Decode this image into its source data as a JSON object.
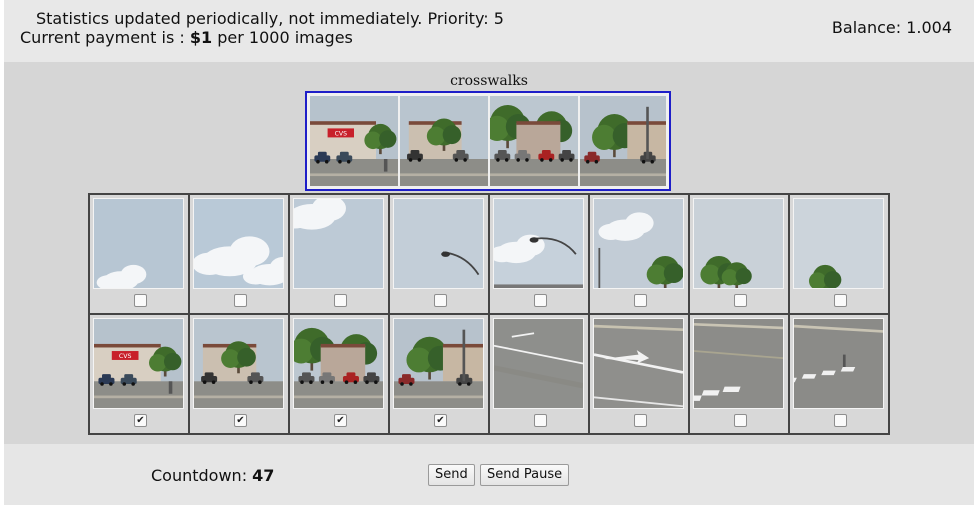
{
  "header": {
    "stats_text": "Statistics updated periodically, not immediately. Priority: 5",
    "payment_prefix": "Current payment is : ",
    "payment_amount": "$1",
    "payment_suffix": " per 1000 images",
    "balance_text": "Balance: 1.004"
  },
  "task": {
    "label": "crosswalks"
  },
  "tiles": [
    {
      "scene": "sky1",
      "checked": false
    },
    {
      "scene": "sky2",
      "checked": false
    },
    {
      "scene": "sky3",
      "checked": false
    },
    {
      "scene": "lamp1",
      "checked": false
    },
    {
      "scene": "lamp2",
      "checked": false
    },
    {
      "scene": "treeRight",
      "checked": false
    },
    {
      "scene": "treeBottom",
      "checked": false
    },
    {
      "scene": "treeBottom2",
      "checked": false
    },
    {
      "scene": "store",
      "checked": true
    },
    {
      "scene": "street1",
      "checked": true
    },
    {
      "scene": "street2",
      "checked": true
    },
    {
      "scene": "street3",
      "checked": true
    },
    {
      "scene": "road1",
      "checked": false
    },
    {
      "scene": "road2",
      "checked": false
    },
    {
      "scene": "cross1",
      "checked": false
    },
    {
      "scene": "cross2",
      "checked": false
    }
  ],
  "footer": {
    "countdown_label": "Countdown: ",
    "countdown_value": "47",
    "send_label": "Send",
    "send_pause_label": "Send Pause"
  }
}
